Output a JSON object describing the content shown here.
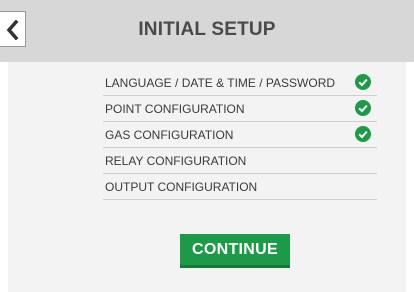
{
  "header": {
    "title": "INITIAL SETUP",
    "back_icon": "chevron-left-icon"
  },
  "setup_list": {
    "items": [
      {
        "label": "LANGUAGE / DATE & TIME / PASSWORD",
        "completed": true
      },
      {
        "label": "POINT CONFIGURATION",
        "completed": true
      },
      {
        "label": "GAS CONFIGURATION",
        "completed": true
      },
      {
        "label": "RELAY CONFIGURATION",
        "completed": false
      },
      {
        "label": "OUTPUT CONFIGURATION",
        "completed": false
      }
    ],
    "check_icon": "check-circle-icon",
    "check_color": "#1c9a48"
  },
  "actions": {
    "continue_label": "CONTINUE",
    "continue_color": "#1c9a48"
  }
}
